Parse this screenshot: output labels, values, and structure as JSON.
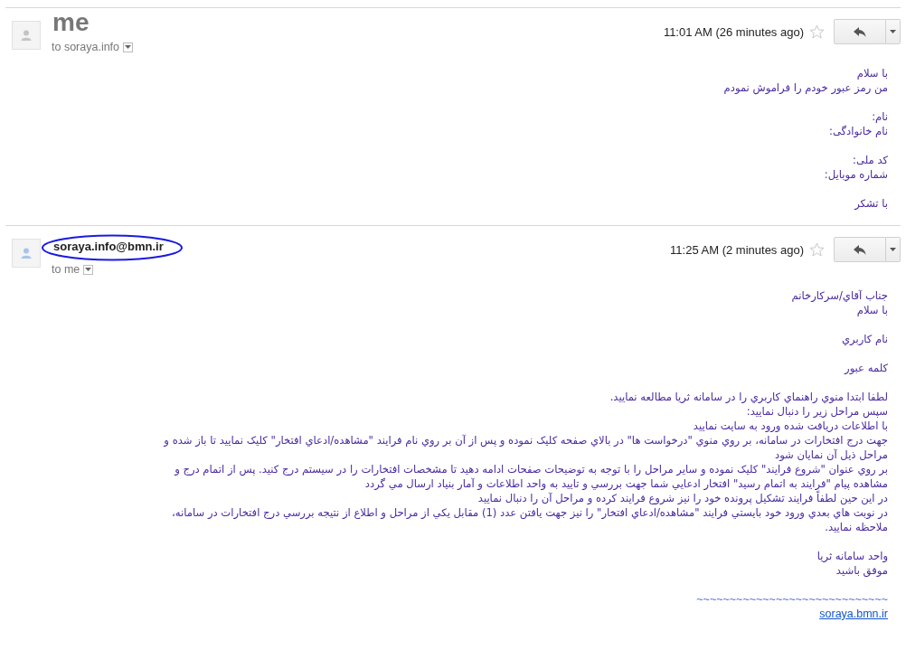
{
  "messages": [
    {
      "sender": "me",
      "large_sender": true,
      "circled": false,
      "avatar": {
        "color": "#c4c4c4"
      },
      "recipient": "to soraya.info",
      "time": "11:01 AM (26 minutes ago)",
      "starred": false,
      "body": [
        [
          "با سلام",
          "من رمز عبور خودم را فراموش نمودم"
        ],
        [
          "نام:",
          "نام خانوادگی:"
        ],
        [
          "کد ملی:",
          "شماره موبایل:"
        ],
        [
          "با تشکر"
        ]
      ]
    },
    {
      "sender": "soraya.info@bmn.ir",
      "large_sender": false,
      "circled": true,
      "avatar": {
        "color": "#a8c4ec"
      },
      "recipient": "to me",
      "time": "11:25 AM (2 minutes ago)",
      "starred": false,
      "body": [
        [
          "جناب آقاي/سرکارخانم",
          "با سلام"
        ],
        [
          "نام کاربري"
        ],
        [
          "کلمه عبور"
        ],
        [
          "لطفا ابتدا منوي راهنماي کاربري را در سامانه ثريا مطالعه نماييد.",
          "سپس مراحل زير را دنبال نماييد:",
          "با اطلاعات دريافت شده ورود به سايت نماييد",
          "جهت درج افتخارات در سامانه، بر روي منوي \"درخواست ها\" در بالاي صفحه کليک نموده و پس از آن بر روي نام فرايند \"مشاهده/ادعاي افتخار\" کليک نماييد تا باز شده و",
          "مراحل ذيل آن نمايان شود",
          "بر روي عنوان \"شروع فرايند\" کليک نموده و ساير مراحل را با توجه به توضيحات صفحات ادامه دهيد تا مشخصات افتخارات را در سيستم درج کنيد. پس از اتمام درج و",
          "مشاهده پيام \"فرايند به اتمام رسيد\" افتخار ادعايي شما جهت بررسي و تاييد به واحد اطلاعات و آمار بنياد ارسال مي گردد",
          "در اين حين لطفاً فرايند تشکيل پرونده خود را نيز شروع فرايند کرده و مراحل آن را دنبال نماييد",
          "در نوبت هاي بعدي ورود خود بايستي فرايند \"مشاهده/ادعاي افتخار\" را نيز جهت يافتن عدد (1) مقابل يکي از مراحل و اطلاع از نتيجه بررسي درج افتخارات در سامانه،",
          "ملاحظه نماييد."
        ],
        [
          "واحد سامانه ثريا",
          "موفق باشيد"
        ]
      ],
      "signature": {
        "rule": "~~~~~~~~~~~~~~~~~~~~~~~~~~~~~",
        "link": "soraya.bmn.ir"
      }
    }
  ]
}
